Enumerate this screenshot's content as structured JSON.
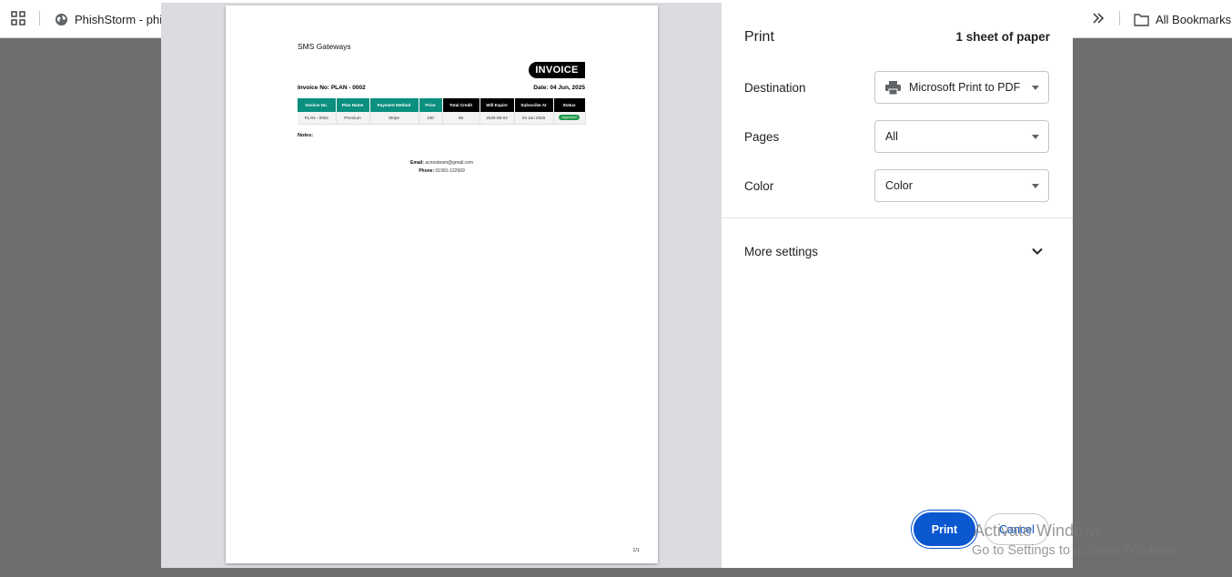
{
  "bookmarks_bar": {
    "tab_label": "PhishStorm - phish",
    "all_bookmarks_label": "All Bookmarks"
  },
  "preview": {
    "company": "SMS Gateways",
    "invoice_badge": "INVOICE",
    "invoice_no": "Invoice No: PLAN - 0002",
    "date": "Date: 04 Jun, 2025",
    "table": {
      "headers": [
        "Invoice No.",
        "Plan Name",
        "Payment Method",
        "Price",
        "Total Credit",
        "Will Expire",
        "Subscribe At",
        "Status"
      ],
      "row": [
        "PLAN - 0002",
        "Premium",
        "Stripe",
        "100",
        "65",
        "2026-06-04",
        "04 Jun 2025",
        "Approved"
      ]
    },
    "notes_label": "Notes:",
    "email_label": "Email:",
    "email_value": "acnooteam@gmail.com",
    "phone_label": "Phone:",
    "phone_value": "01991-122669",
    "page_number": "1/1"
  },
  "settings": {
    "title": "Print",
    "sheets": "1 sheet of paper",
    "destination_label": "Destination",
    "destination_value": "Microsoft Print to PDF",
    "pages_label": "Pages",
    "pages_value": "All",
    "color_label": "Color",
    "color_value": "Color",
    "more_settings_label": "More settings",
    "print_button": "Print",
    "cancel_button": "Cancel"
  },
  "watermark": {
    "line1": "Activate Windows",
    "line2": "Go to Settings to activate Windows."
  },
  "colors": {
    "accent": "#0b57d0",
    "table_teal": "#0b8f7e",
    "status_green": "#1f9a4a"
  }
}
